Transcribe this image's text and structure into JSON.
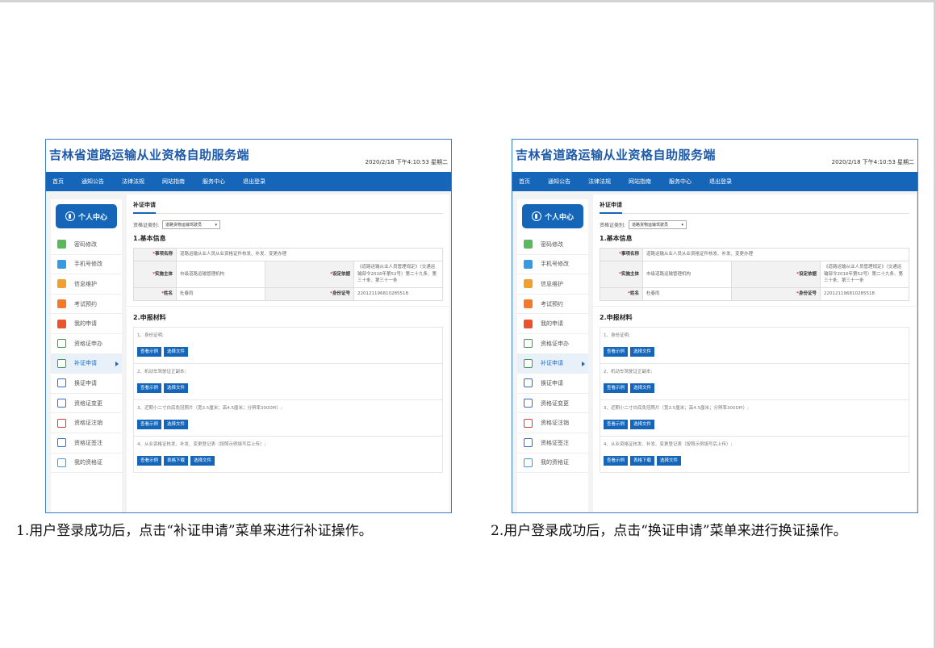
{
  "screens": [
    {
      "title": "吉林省道路运输从业资格自助服务端",
      "datetime": "2020/2/18 下午4:10:53 星期二",
      "nav": [
        "首页",
        "通知公告",
        "法律法规",
        "网站指南",
        "服务中心",
        "退出登录"
      ],
      "user_center": "个人中心",
      "menu": [
        {
          "label": "密码修改",
          "icon": "lock-icon"
        },
        {
          "label": "手机号修改",
          "icon": "edit-icon"
        },
        {
          "label": "信息维护",
          "icon": "folder-icon"
        },
        {
          "label": "考试预约",
          "icon": "calendar-icon"
        },
        {
          "label": "我的申请",
          "icon": "bell-icon"
        },
        {
          "label": "资格证申办",
          "icon": "certificate-icon"
        },
        {
          "label": "补证申请",
          "icon": "certificate-icon"
        },
        {
          "label": "换证申请",
          "icon": "certificate-icon"
        },
        {
          "label": "资格证变更",
          "icon": "certificate-icon"
        },
        {
          "label": "资格证注销",
          "icon": "certificate-icon"
        },
        {
          "label": "资格证签注",
          "icon": "certificate-icon"
        },
        {
          "label": "我的资格证",
          "icon": "id-card-icon"
        }
      ],
      "active_menu": "补证申请",
      "tab": "补证申请",
      "cert_type_label": "资格证类别:",
      "cert_type_value": "道路货物运输驾驶员",
      "section1": "1.基本信息",
      "info": {
        "item_name_label": "事项名称",
        "item_name": "道路运输从业人员从业资格证件核发、补发、变更办理",
        "impl_label": "实施主体",
        "impl": "市级道路运输管理机构",
        "basis_label": "设定依据",
        "basis": "《道路运输从业人员管理规定》（交通运输部令2016年第52号）第二十九条、第三十条、第三十一条",
        "name_label": "姓名",
        "name": "杜春雨",
        "id_label": "身份证号",
        "id": "220121196810285518"
      },
      "section2": "2.申报材料",
      "materials": [
        {
          "label": "1、身份证明;",
          "buttons": [
            "查看示例",
            "选择文件"
          ]
        },
        {
          "label": "2、机动车驾驶证正副本;",
          "buttons": [
            "查看示例",
            "选择文件"
          ]
        },
        {
          "label": "3、近期小二寸白底免冠照片（宽3.5厘米；高4.5厘米；分辨率300DPI）;",
          "buttons": [
            "查看示例",
            "选择文件"
          ]
        },
        {
          "label": "4、从业资格证核发、补发、变更登记表（按照示例填写后上传）;",
          "buttons": [
            "查看示例",
            "表格下载",
            "选择文件"
          ]
        }
      ]
    },
    {
      "title": "吉林省道路运输从业资格自助服务端",
      "datetime": "2020/2/18 下午4:10:53 星期二",
      "nav": [
        "首页",
        "通知公告",
        "法律法规",
        "网站指南",
        "服务中心",
        "退出登录"
      ],
      "user_center": "个人中心",
      "menu": [
        {
          "label": "密码修改",
          "icon": "lock-icon"
        },
        {
          "label": "手机号修改",
          "icon": "edit-icon"
        },
        {
          "label": "信息维护",
          "icon": "folder-icon"
        },
        {
          "label": "考试预约",
          "icon": "calendar-icon"
        },
        {
          "label": "我的申请",
          "icon": "bell-icon"
        },
        {
          "label": "资格证申办",
          "icon": "certificate-icon"
        },
        {
          "label": "补证申请",
          "icon": "certificate-icon"
        },
        {
          "label": "换证申请",
          "icon": "certificate-icon"
        },
        {
          "label": "资格证变更",
          "icon": "certificate-icon"
        },
        {
          "label": "资格证注销",
          "icon": "certificate-icon"
        },
        {
          "label": "资格证签注",
          "icon": "certificate-icon"
        },
        {
          "label": "我的资格证",
          "icon": "id-card-icon"
        }
      ],
      "active_menu": "补证申请",
      "tab": "补证申请",
      "cert_type_label": "资格证类别:",
      "cert_type_value": "道路货物运输驾驶员",
      "section1": "1.基本信息",
      "info": {
        "item_name_label": "事项名称",
        "item_name": "道路运输从业人员从业资格证件核发、补发、变更办理",
        "impl_label": "实施主体",
        "impl": "市级道路运输管理机构",
        "basis_label": "设定依据",
        "basis": "《道路运输从业人员管理规定》（交通运输部令2016年第52号）第二十九条、第三十条、第三十一条",
        "name_label": "姓名",
        "name": "杜春雨",
        "id_label": "身份证号",
        "id": "220121196810285518"
      },
      "section2": "2.申报材料",
      "materials": [
        {
          "label": "1、身份证明;",
          "buttons": [
            "查看示例",
            "选择文件"
          ]
        },
        {
          "label": "2、机动车驾驶证正副本;",
          "buttons": [
            "查看示例",
            "选择文件"
          ]
        },
        {
          "label": "3、近期小二寸白底免冠照片（宽3.5厘米；高4.5厘米；分辨率300DPI）;",
          "buttons": [
            "查看示例",
            "选择文件"
          ]
        },
        {
          "label": "4、从业资格证核发、补发、变更登记表（按照示例填写后上传）;",
          "buttons": [
            "查看示例",
            "表格下载",
            "选择文件"
          ]
        }
      ]
    }
  ],
  "captions": [
    "1.用户登录成功后，点击“补证申请”菜单来进行补证操作。",
    "2.用户登录成功后，点击“换证申请”菜单来进行换证操作。"
  ]
}
